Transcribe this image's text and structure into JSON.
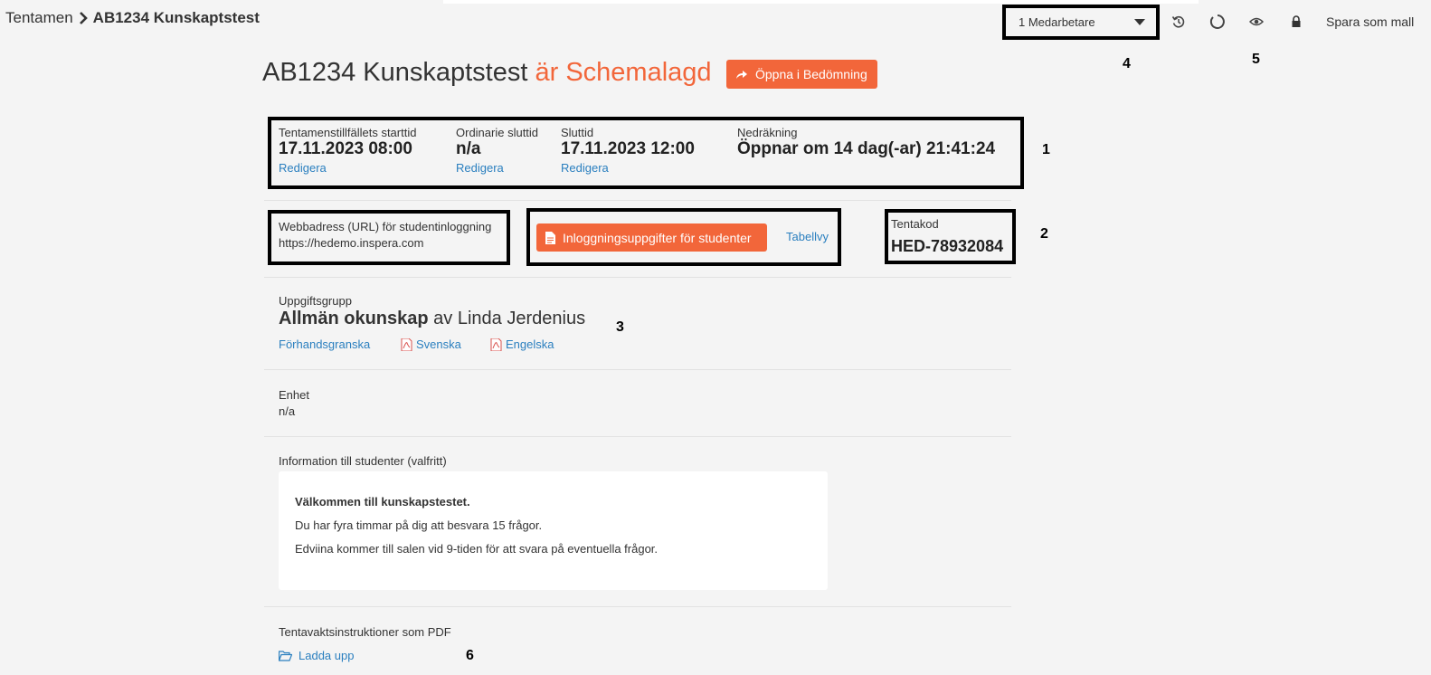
{
  "breadcrumb": {
    "root": "Tentamen",
    "current": "AB1234 Kunskaptstest"
  },
  "toolbar": {
    "collaborators": "1 Medarbetare",
    "save_template": "Spara som mall",
    "icons": [
      "history-icon",
      "refresh-icon",
      "eye-icon",
      "lock-icon"
    ]
  },
  "annotations": {
    "n1": "1",
    "n2": "2",
    "n3": "3",
    "n4": "4",
    "n5": "5",
    "n6": "6"
  },
  "title": {
    "name": "AB1234 Kunskaptstest",
    "status": "är Schemalagd",
    "open_button": "Öppna i Bedömning"
  },
  "schedule": {
    "start": {
      "label": "Tentamenstillfällets starttid",
      "value": "17.11.2023 08:00",
      "edit": "Redigera"
    },
    "ordinary_end": {
      "label": "Ordinarie sluttid",
      "value": "n/a",
      "edit": "Redigera"
    },
    "end": {
      "label": "Sluttid",
      "value": "17.11.2023 12:00",
      "edit": "Redigera"
    },
    "countdown": {
      "label": "Nedräkning",
      "value": "Öppnar om 14 dag(-ar) 21:41:24"
    }
  },
  "login": {
    "url_label": "Webbadress (URL) för studentinloggning",
    "url": "https://hedemo.inspera.com",
    "button": "Inloggningsuppgifter för studenter",
    "table_view": "Tabellvy",
    "code_label": "Tentakod",
    "code": "HED-78932084"
  },
  "task_group": {
    "label": "Uppgiftsgrupp",
    "name": "Allmän okunskap",
    "by": "av Linda Jerdenius",
    "preview": "Förhandsgranska",
    "pdf_sv": "Svenska",
    "pdf_en": "Engelska"
  },
  "unit": {
    "label": "Enhet",
    "value": "n/a"
  },
  "info": {
    "label": "Information till studenter (valfritt)",
    "heading": "Välkommen till kunskapstestet.",
    "line1": "Du har fyra timmar på dig att besvara 15 frågor.",
    "line2": "Edviina kommer till salen vid 9-tiden för att svara på eventuella frågor."
  },
  "invigilator": {
    "label": "Tentavaktsinstruktioner som PDF",
    "upload": "Ladda upp"
  },
  "colors": {
    "accent": "#f2663a",
    "link": "#2a7fbf",
    "background": "#f4f4f4"
  }
}
